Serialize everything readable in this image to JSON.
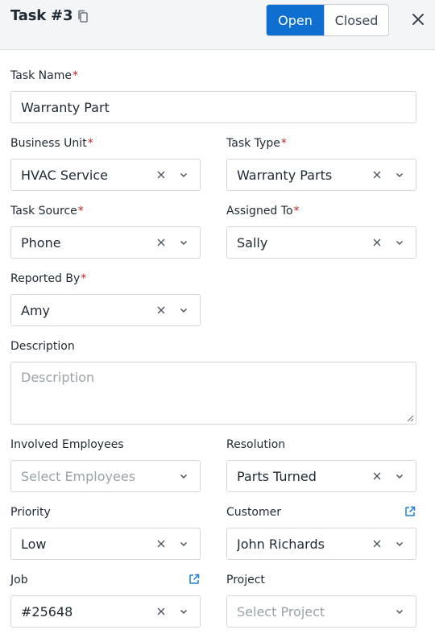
{
  "header": {
    "title": "Task #3",
    "status_options": [
      "Open",
      "Closed"
    ],
    "active_status": "Open"
  },
  "form": {
    "task_name": {
      "label": "Task Name",
      "required": "*",
      "value": "Warranty Part"
    },
    "business_unit": {
      "label": "Business Unit",
      "required": "*",
      "value": "HVAC Service"
    },
    "task_type": {
      "label": "Task Type",
      "required": "*",
      "value": "Warranty Parts"
    },
    "task_source": {
      "label": "Task Source",
      "required": "*",
      "value": "Phone"
    },
    "assigned_to": {
      "label": "Assigned To",
      "required": "*",
      "value": "Sally"
    },
    "reported_by": {
      "label": "Reported By",
      "required": "*",
      "value": "Amy"
    },
    "description": {
      "label": "Description",
      "placeholder": "Description"
    },
    "involved_employees": {
      "label": "Involved Employees",
      "placeholder": "Select Employees"
    },
    "resolution": {
      "label": "Resolution",
      "value": "Parts Turned"
    },
    "priority": {
      "label": "Priority",
      "value": "Low"
    },
    "customer": {
      "label": "Customer",
      "value": "John Richards"
    },
    "job": {
      "label": "Job",
      "value": "#25648"
    },
    "project": {
      "label": "Project",
      "placeholder": "Select Project"
    }
  },
  "colors": {
    "accent": "#0e6fd1",
    "required": "#c0242a",
    "placeholder": "#9aa3ab"
  },
  "icons": [
    "copy-icon",
    "close-icon",
    "clear-icon",
    "chevron-down-icon",
    "external-link-icon"
  ]
}
